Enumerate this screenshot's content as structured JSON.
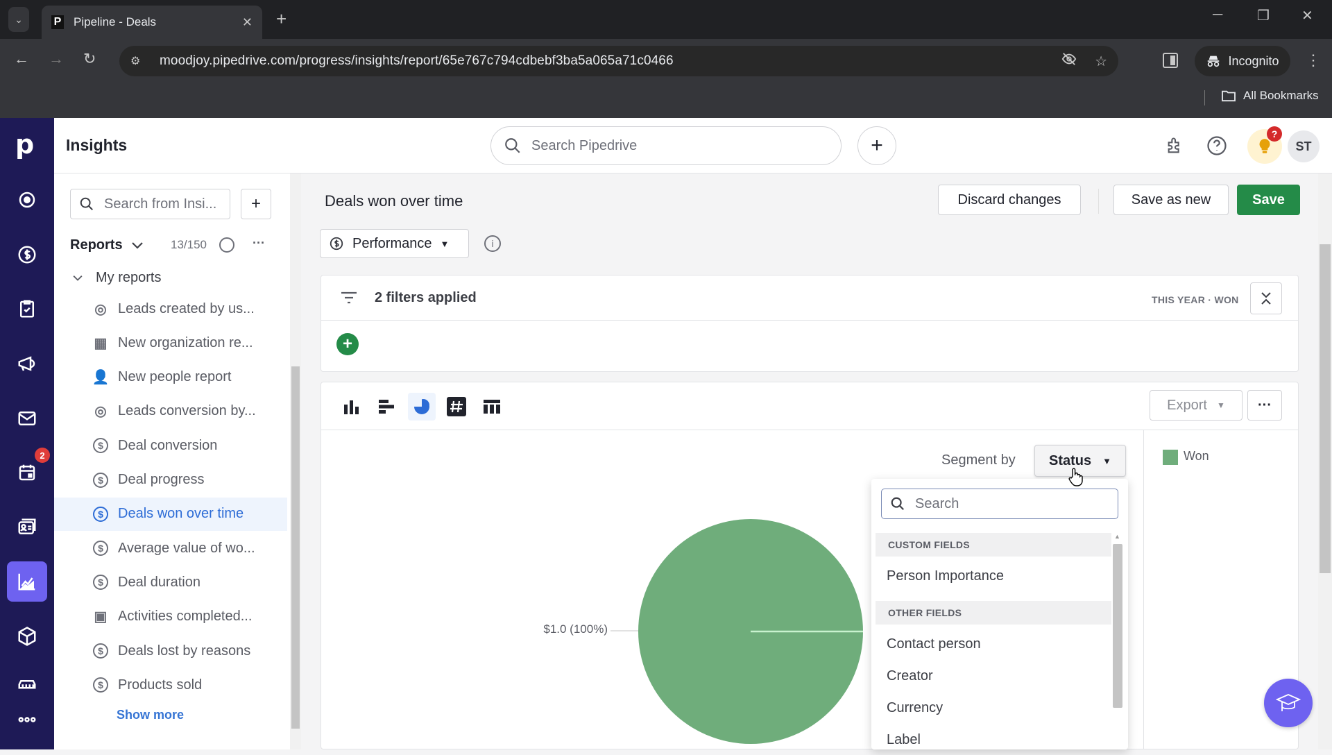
{
  "browser": {
    "tab_title": "Pipeline - Deals",
    "tab_favicon": "P",
    "url": "moodjoy.pipedrive.com/progress/insights/report/65e767c794cdbebf3ba5a065a71c0466",
    "profile_label": "Incognito",
    "bookmarks_label": "All Bookmarks",
    "icons": {
      "back": "←",
      "forward": "→",
      "reload": "↻",
      "new_tab": "+",
      "close_tab": "✕",
      "minimize": "─",
      "restore": "❐",
      "close": "✕",
      "tab_list": "⌄",
      "kebab": "⋮",
      "eye_off": "👁",
      "star": "☆",
      "folder": "🗀",
      "incognito": "🕵",
      "tune": "⚙"
    }
  },
  "app": {
    "logo": "p",
    "section_title": "Insights",
    "search_placeholder": "Search Pipedrive",
    "add_label": "+",
    "avatar_initials": "ST",
    "tip_badge": "?",
    "rail_badge": "2",
    "icons": {
      "extensions": "⧉",
      "help": "?",
      "bulb": "💡"
    }
  },
  "left_panel": {
    "search_placeholder": "Search from Insi...",
    "add_label": "+",
    "reports_label": "Reports",
    "reports_count": "13/150",
    "more_label": "···",
    "group_label": "My reports",
    "items": [
      {
        "label": "Leads created by us...",
        "icon": "◎"
      },
      {
        "label": "New organization re...",
        "icon": "▦"
      },
      {
        "label": "New people report",
        "icon": "👤"
      },
      {
        "label": "Leads conversion by...",
        "icon": "◎"
      },
      {
        "label": "Deal conversion",
        "icon": "$"
      },
      {
        "label": "Deal progress",
        "icon": "$"
      },
      {
        "label": "Deals won over time",
        "icon": "$",
        "active": true
      },
      {
        "label": "Average value of wo...",
        "icon": "$"
      },
      {
        "label": "Deal duration",
        "icon": "$"
      },
      {
        "label": "Activities completed...",
        "icon": "▣"
      },
      {
        "label": "Deals lost by reasons",
        "icon": "$"
      },
      {
        "label": "Products sold",
        "icon": "$"
      }
    ],
    "show_more": "Show more"
  },
  "report": {
    "title": "Deals won over time",
    "discard_label": "Discard changes",
    "save_new_label": "Save as new",
    "save_label": "Save",
    "type_label": "Performance",
    "filters_label": "2 filters applied",
    "filter_tags": "THIS YEAR · WON",
    "export_label": "Export",
    "more_label": "···",
    "segment_label": "Segment by",
    "segment_value": "Status",
    "accent": "#248b48",
    "chart_types": [
      "column",
      "bar",
      "pie",
      "scorecard",
      "table"
    ],
    "active_chart_type": "pie"
  },
  "segment_dropdown": {
    "search_placeholder": "Search",
    "groups": [
      {
        "label": "CUSTOM FIELDS",
        "options": [
          "Person Importance"
        ]
      },
      {
        "label": "OTHER FIELDS",
        "options": [
          "Contact person",
          "Creator",
          "Currency",
          "Label"
        ]
      }
    ]
  },
  "chart_data": {
    "type": "pie",
    "title": "Deals won over time",
    "series": [
      {
        "name": "Won",
        "value": 1.0,
        "percent": 100,
        "color": "#6fad7b"
      }
    ],
    "data_labels": [
      "$1.0 (100%)"
    ],
    "legend": {
      "entries": [
        "Won"
      ],
      "placement": "right"
    }
  }
}
